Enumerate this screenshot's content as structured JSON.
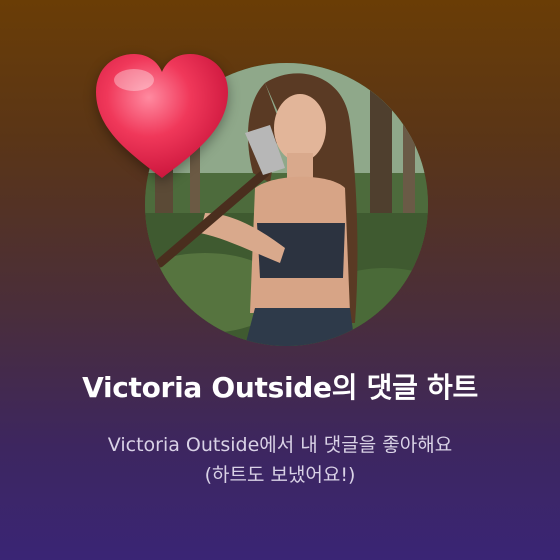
{
  "notification": {
    "title": "Victoria Outside의 댓글 하트",
    "message_line1": "Victoria Outside에서 내 댓글을 좋아해요",
    "message_line2": "(하트도 보냈어요!)"
  },
  "icons": {
    "reaction": "heart-icon"
  },
  "colors": {
    "background_top": "#6a3d06",
    "background_bottom": "#3a2575",
    "heart": "#e8294f",
    "title_text": "#ffffff",
    "message_text": "#d9d2e6"
  }
}
